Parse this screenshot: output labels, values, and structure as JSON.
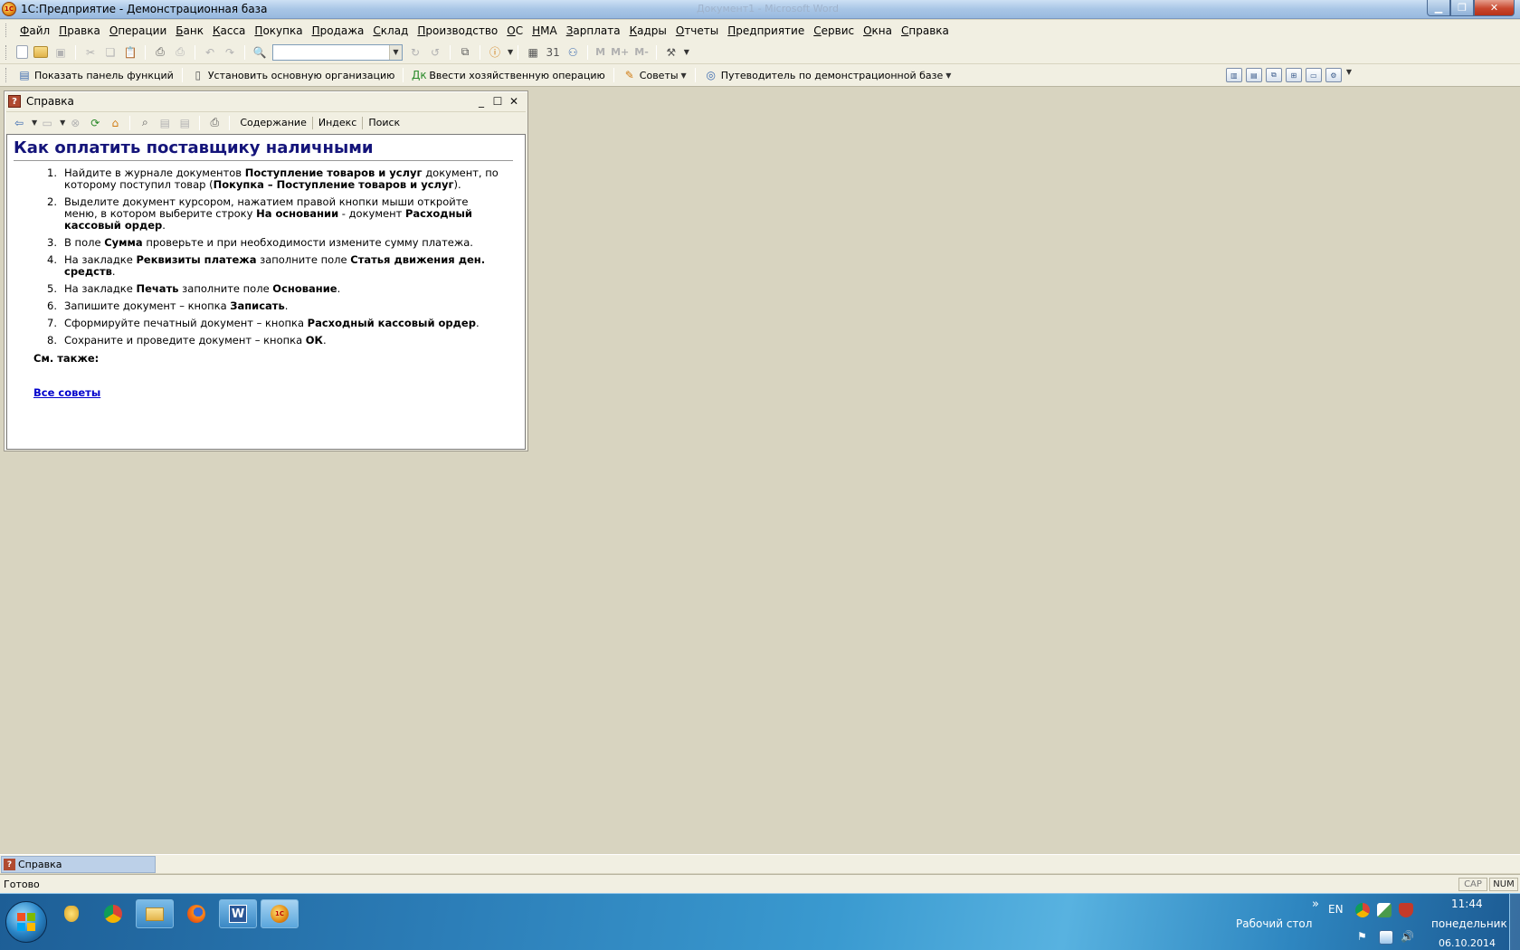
{
  "window": {
    "title": "1С:Предприятие - Демонстрационная база",
    "app_icon_text": "1С",
    "faint_title_text": "Документ1 - Microsoft Word"
  },
  "menubar": {
    "items": [
      "Файл",
      "Правка",
      "Операции",
      "Банк",
      "Касса",
      "Покупка",
      "Продажа",
      "Склад",
      "Производство",
      "ОС",
      "НМА",
      "Зарплата",
      "Кадры",
      "Отчеты",
      "Предприятие",
      "Сервис",
      "Окна",
      "Справка"
    ]
  },
  "toolbar1": {
    "search_value": "",
    "text_m": "M",
    "text_mplus": "M+",
    "text_mminus": "M-"
  },
  "toolbar2": {
    "show_functions": "Показать панель функций",
    "set_org": "Установить основную организацию",
    "enter_operation": "Ввести хозяйственную операцию",
    "hints": "Советы",
    "guide": "Путеводитель по демонстрационной базе"
  },
  "help_window": {
    "title": "Справка",
    "toolbar": {
      "contents": "Содержание",
      "index": "Индекс",
      "search": "Поиск"
    },
    "heading": "Как оплатить поставщику наличными",
    "steps": [
      {
        "num": "1.",
        "parts": [
          {
            "t": "Найдите в журнале документов ",
            "b": false
          },
          {
            "t": "Поступление товаров и услуг",
            "b": true
          },
          {
            "t": " документ, по которому поступил товар (",
            "b": false
          },
          {
            "t": "Покупка – Поступление товаров и услуг",
            "b": true
          },
          {
            "t": ").",
            "b": false
          }
        ]
      },
      {
        "num": "2.",
        "parts": [
          {
            "t": "Выделите документ курсором, нажатием правой кнопки мыши откройте меню, в котором выберите строку ",
            "b": false
          },
          {
            "t": "На основании",
            "b": true
          },
          {
            "t": " - документ ",
            "b": false
          },
          {
            "t": "Расходный кассовый ордер",
            "b": true
          },
          {
            "t": ".",
            "b": false
          }
        ]
      },
      {
        "num": "3.",
        "parts": [
          {
            "t": "В поле ",
            "b": false
          },
          {
            "t": "Сумма",
            "b": true
          },
          {
            "t": " проверьте и при необходимости измените сумму платежа.",
            "b": false
          }
        ]
      },
      {
        "num": "4.",
        "parts": [
          {
            "t": "На закладке ",
            "b": false
          },
          {
            "t": "Реквизиты платежа",
            "b": true
          },
          {
            "t": " заполните поле ",
            "b": false
          },
          {
            "t": "Статья движения ден. средств",
            "b": true
          },
          {
            "t": ".",
            "b": false
          }
        ]
      },
      {
        "num": "5.",
        "parts": [
          {
            "t": "На закладке ",
            "b": false
          },
          {
            "t": "Печать",
            "b": true
          },
          {
            "t": " заполните поле ",
            "b": false
          },
          {
            "t": "Основание",
            "b": true
          },
          {
            "t": ".",
            "b": false
          }
        ]
      },
      {
        "num": "6.",
        "parts": [
          {
            "t": "Запишите документ – кнопка ",
            "b": false
          },
          {
            "t": "Записать",
            "b": true
          },
          {
            "t": ".",
            "b": false
          }
        ]
      },
      {
        "num": "7.",
        "parts": [
          {
            "t": "Сформируйте печатный документ – кнопка ",
            "b": false
          },
          {
            "t": "Расходный кассовый ордер",
            "b": true
          },
          {
            "t": ".",
            "b": false
          }
        ]
      },
      {
        "num": "8.",
        "parts": [
          {
            "t": "Сохраните и проведите документ – кнопка ",
            "b": false
          },
          {
            "t": "ОК",
            "b": true
          },
          {
            "t": ".",
            "b": false
          }
        ]
      }
    ],
    "see_also": "См. также:",
    "all_hints_link": "Все советы"
  },
  "mdi_tabs": [
    {
      "label": "Справка",
      "active": true
    }
  ],
  "statusbar": {
    "text": "Готово",
    "cap": "CAP",
    "num": "NUM"
  },
  "taskbar": {
    "desktop_label": "Рабочий стол",
    "language": "EN",
    "time": "11:44",
    "weekday": "понедельник",
    "date": "06.10.2014",
    "expand": "»"
  },
  "colors": {
    "heading": "#14147a",
    "link": "#0000cc",
    "mdi_background": "#d8d4c0",
    "panel": "#f1efe2"
  }
}
